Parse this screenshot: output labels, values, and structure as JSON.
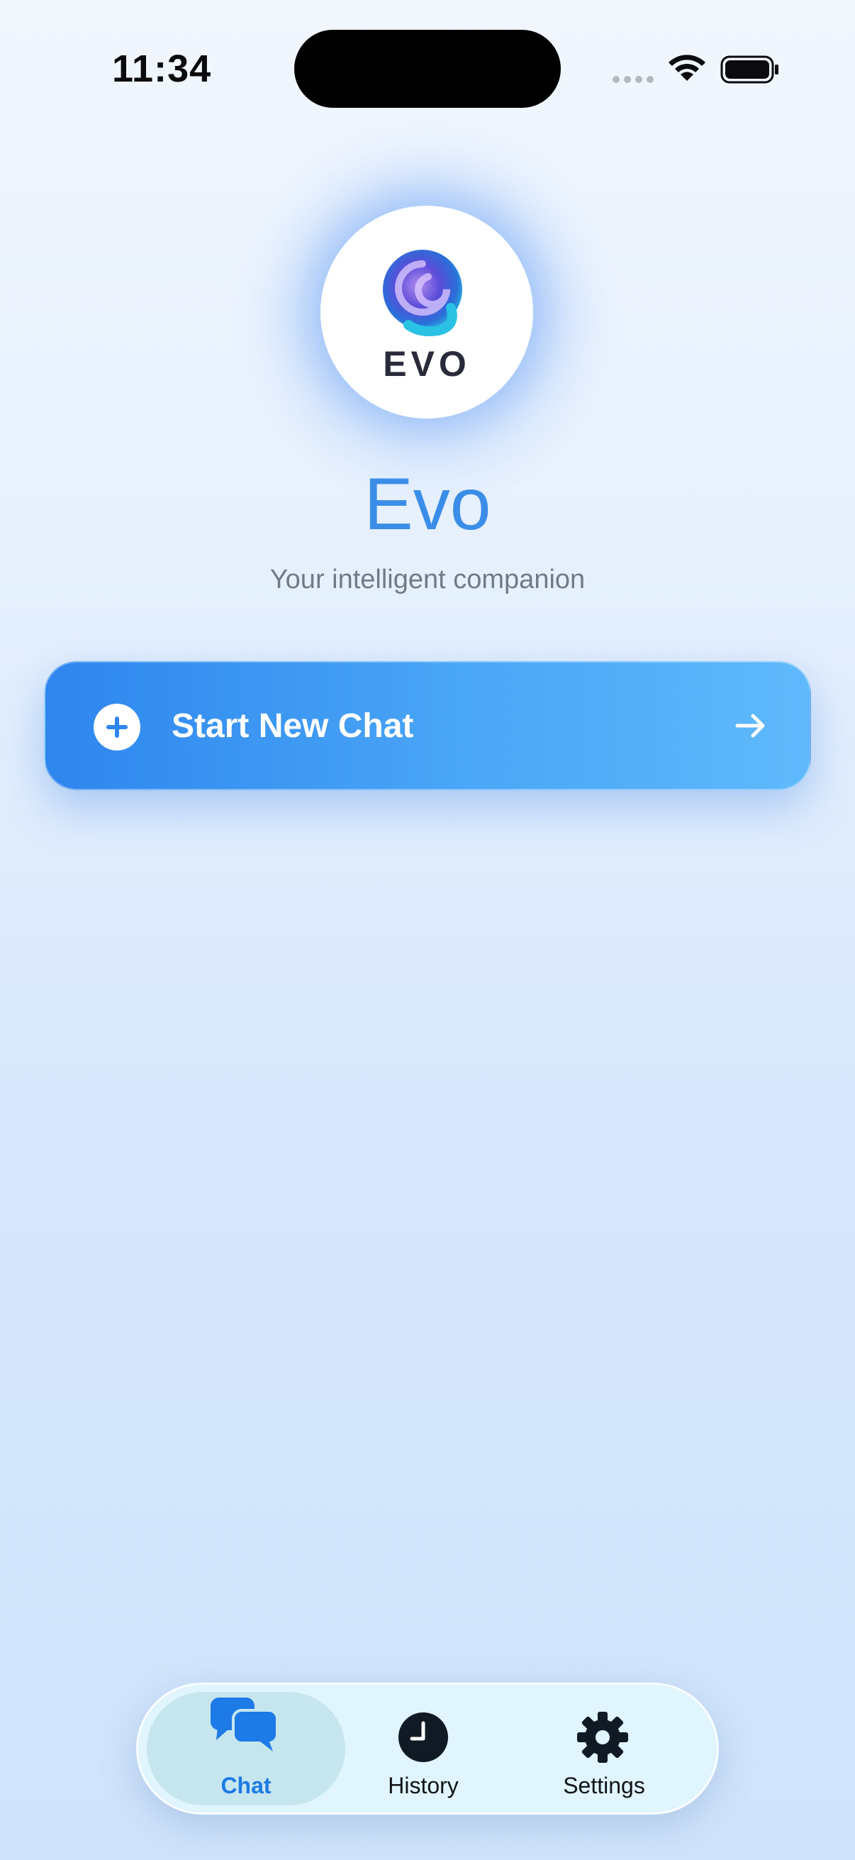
{
  "status_bar": {
    "time": "11:34",
    "icons": [
      "cellular-signal-icon",
      "wifi-icon",
      "battery-icon"
    ]
  },
  "hero": {
    "logo_text": "EVO",
    "title": "Evo",
    "subtitle": "Your intelligent companion"
  },
  "cta": {
    "label": "Start New Chat",
    "leading_icon": "plus-circle-icon",
    "trailing_icon": "arrow-right-icon"
  },
  "tabbar": {
    "items": [
      {
        "label": "Chat",
        "icon": "chat-bubbles-icon",
        "selected": true
      },
      {
        "label": "History",
        "icon": "clock-icon",
        "selected": false
      },
      {
        "label": "Settings",
        "icon": "gear-icon",
        "selected": false
      }
    ]
  },
  "colors": {
    "accent": "#2E86EE",
    "title": "#3A8EE8",
    "tab_selected": "#1D7AE6",
    "tabbar_bg": "#E0F5FD"
  }
}
